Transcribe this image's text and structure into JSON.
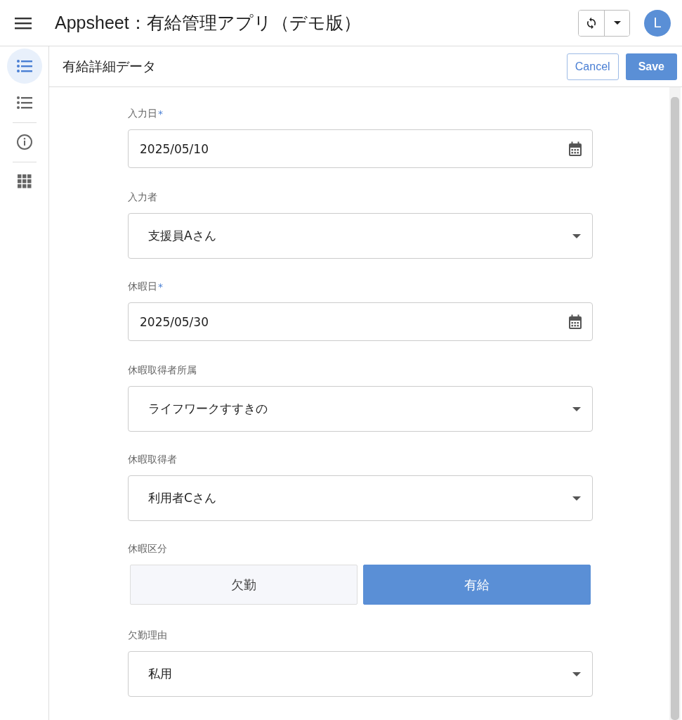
{
  "app_bar": {
    "title": "Appsheet：有給管理アプリ（デモ版）",
    "avatar": "L"
  },
  "sidebar": {
    "items": [
      {
        "kind": "list",
        "selected": true
      },
      {
        "kind": "list",
        "selected": false
      },
      {
        "kind": "info",
        "selected": false
      },
      {
        "kind": "grid",
        "selected": false
      }
    ]
  },
  "form": {
    "title": "有給詳細データ",
    "buttons": {
      "cancel": "Cancel",
      "save": "Save"
    },
    "fields": [
      {
        "kind": "date",
        "label": "入力日",
        "required_mark": "*",
        "value": "2025/05/10"
      },
      {
        "kind": "select",
        "label": "入力者",
        "value": "支援員Aさん"
      },
      {
        "kind": "date",
        "label": "休暇日",
        "required_mark": "*",
        "value": "2025/05/30"
      },
      {
        "kind": "select",
        "label": "休暇取得者所属",
        "value": "ライフワークすすきの"
      },
      {
        "kind": "select",
        "label": "休暇取得者",
        "value": "利用者Cさん"
      },
      {
        "kind": "choice",
        "label": "休暇区分",
        "options": [
          {
            "label": "欠勤",
            "selected": false
          },
          {
            "label": "有給",
            "selected": true
          }
        ]
      },
      {
        "kind": "select",
        "label": "欠勤理由",
        "value": "私用"
      }
    ]
  }
}
